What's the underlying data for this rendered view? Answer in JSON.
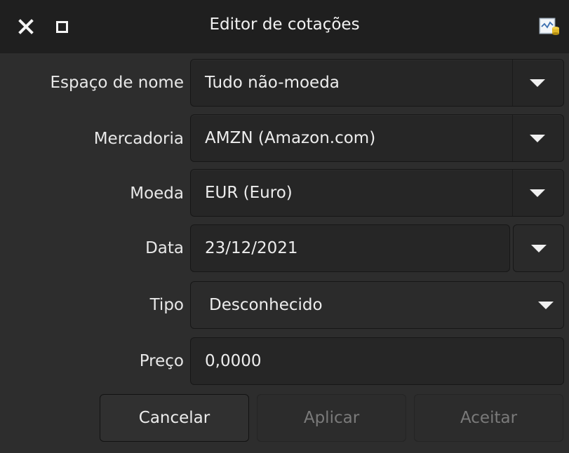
{
  "window": {
    "title": "Editor de cotações",
    "controls": {
      "close_icon": "close-icon",
      "maximize_icon": "maximize-icon",
      "app_icon": "price-editor-app-icon"
    }
  },
  "form": {
    "namespace": {
      "label": "Espaço de nome",
      "value": "Tudo não-moeda"
    },
    "commodity": {
      "label": "Mercadoria",
      "value": "AMZN (Amazon.com)"
    },
    "currency": {
      "label": "Moeda",
      "value": "EUR (Euro)"
    },
    "date": {
      "label": "Data",
      "value": "23/12/2021"
    },
    "type": {
      "label": "Tipo",
      "value": "Desconhecido"
    },
    "price": {
      "label": "Preço",
      "value": "0,0000"
    }
  },
  "buttons": {
    "cancel": "Cancelar",
    "apply": "Aplicar",
    "ok": "Aceitar"
  },
  "colors": {
    "background": "#2d2d2d",
    "titlebar": "#1f1f1f",
    "field": "#262626",
    "text": "#e6e6e6",
    "disabled_text": "#7a7a7a"
  }
}
